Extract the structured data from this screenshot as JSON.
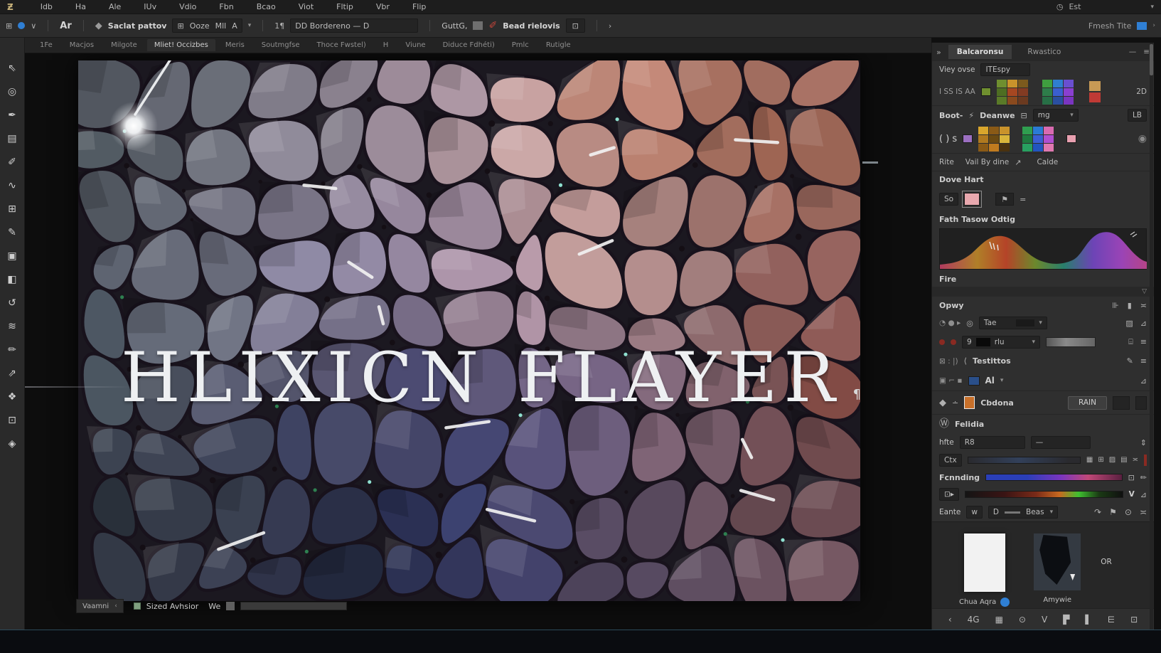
{
  "colors": {
    "accent_blue": "#2f7fd4",
    "panel_bg": "#2f2f2f",
    "canvas_bg": "#0d0d0d",
    "title_text": "#eef0f2",
    "logo_gold": "#c8b27a"
  },
  "menu": {
    "logo": "Ƶ",
    "items": [
      "Idb",
      "Ha",
      "Ale",
      "IUv",
      "Vdio",
      "Fbn",
      "Bcao",
      "Viot",
      "Fltip",
      "Vbr",
      "Flip"
    ],
    "right_label": "Est",
    "clock_icon": "◷",
    "caret": "▾"
  },
  "options_bar": {
    "grid_icon": "⊞",
    "chevron": "∨",
    "brand": "Ar",
    "diamond_icon": "◆",
    "select_label": "Saclat pattov",
    "dd_seg1": "Ooze",
    "dd_seg2": "Mll",
    "dd_seg3": "A",
    "para_icon": "1¶",
    "long_field": "DD Bordereno — D",
    "small_field": "GuttG,",
    "brush_icon": "✐",
    "metrics_label": "Bead rielovis",
    "box_icon": "⊡",
    "right_label": "Fmesh Tite",
    "right_chevron": "›"
  },
  "tabstrip": {
    "tabs": [
      "1Fe",
      "Macjos",
      "Milgote",
      "Mliet! Occizbes",
      "Meris",
      "Soutmgfse",
      "Thoce Fwstel)",
      "H",
      "Viune",
      "Diduce Fdhéti)",
      "Pmlc",
      "Rutigle"
    ]
  },
  "tools": {
    "items": [
      "⇖",
      "◎",
      "✒",
      "▤",
      "✐",
      "∿",
      "⊞",
      "✎",
      "▣",
      "◧",
      "↺",
      "≋",
      "✏",
      "⇗",
      "❖",
      "⊡",
      "◈"
    ]
  },
  "canvas": {
    "title_word1": "HLIXICN",
    "title_word2": "FLAYER",
    "title_mark": "¶"
  },
  "status_bar": {
    "left_label": "Vaamni",
    "left_chevron": "‹",
    "doc_label": "Sized Avhsior",
    "zoom_label": "We"
  },
  "right_panel": {
    "collapse_icon": "»",
    "tab_active": "Balcaronsu",
    "tab_inactive": "Rwastico",
    "tab_min_icon": "—",
    "tab_menu_icon": "≡",
    "view_label1": "Viey ovse",
    "view_label2": "ITEspy",
    "swatch_label": "I SS IS AA",
    "swatch_suffix": "2D",
    "swatches_a": [
      "#6f8f2f",
      "#c9932b",
      "#7c5a1d",
      "#4e6e22",
      "#a64721",
      "#833b22",
      "#5a7a28",
      "#8a4a1e",
      "#6b3a20"
    ],
    "swatches_b": [
      "#3f9e3f",
      "#2f7fd0",
      "#6a4fd0",
      "#2e7d4a",
      "#3a5fd0",
      "#8a3fd0",
      "#276f46",
      "#2a4fa0",
      "#7a35c0"
    ],
    "swatch_pair": [
      "#c89a55",
      "#c03a35"
    ],
    "boot_label": "Boot-",
    "boot_bolt_icon": "⚡",
    "boot_label2": "Deanwe",
    "boot_grid_icon": "⊟",
    "boot_dd": "mg",
    "boot_btn": "LB",
    "row2_prefix": "( ) s",
    "row2_purple": "#9b6fc0",
    "swatches_c": [
      "#d9a62c",
      "#8a5a16",
      "#c9932b",
      "#b0791f",
      "#6b4a12",
      "#d9b53a",
      "#8a5a16",
      "#c07b1f",
      "#4a3210"
    ],
    "swatches_d": [
      "#2f9e4f",
      "#2a7bd4",
      "#d86ab0",
      "#1f7a3f",
      "#3a5fd4",
      "#b04fd0",
      "#28a060",
      "#2255c0",
      "#e078b0"
    ],
    "row2_pink": "#e8a0b0",
    "eye_icon": "◉",
    "link1": "Rite",
    "link2": "Vail By dine",
    "link_arrow": "↗",
    "link3": "Calde",
    "dove_header": "Dove Hart",
    "so_label": "So",
    "so_swatch": "#e8a8ae",
    "filter_icon": "⚑",
    "eq_icon": "=",
    "gradient_label": "Fath Tasow Odtig",
    "fire_label": "Fire",
    "collapse2_icon": "▽",
    "opacity_header": "Opwy",
    "op_icons": [
      "⊪",
      "▮",
      "≍"
    ],
    "tae_prefix_icons": "◔ ● ▸",
    "tae_circle_icon": "◎",
    "tae_label": "Tae",
    "tae_right1": "▨",
    "tae_right2": "⊿",
    "rlu_num": "9",
    "rlu_label": "rlu",
    "rlu_right1": "⌸",
    "rlu_right2": "≡",
    "test_prefix": "⊠ : |)",
    "test_pen_icon": "⟨",
    "test_label": "Testittos",
    "test_right1": "✎",
    "test_right2": "≡",
    "al_icons": "▣ ⌐ ▪",
    "al_label": "Al",
    "al_right": "⊿",
    "cb_icon1": "◆",
    "cb_icon2": "∸",
    "cb_swatch": "#c8702a",
    "cb_label": "Cbdona",
    "cb_btn": "RAIN",
    "fel_icon": "Ⓦ",
    "fel_label": "Felidia",
    "hfte_label": "hfte",
    "hfte_val": "R8",
    "hfte_val2": "—",
    "hfte_right": "⇕",
    "ctx_label": "Ctx",
    "ctx_icons": [
      "▦",
      "⊞",
      "▨",
      "▤",
      "≍"
    ],
    "feather_label": "Fcnnding",
    "feather_right1": "⊡",
    "feather_right2": "✏",
    "grad2_icon": "⊡▸",
    "grad2_v": "V",
    "grad2_right": "⊿",
    "eante_label": "Eante",
    "eante_b": "w",
    "eante_c": "D",
    "eante_d": "Beas",
    "eante_icons": [
      "↷",
      "⚑",
      "⊙",
      "≍"
    ],
    "thumb1_label": "Chua Aqra",
    "thumb2_label": "Amywie",
    "thumb_note": "OR",
    "bottom_icons": [
      "‹",
      "4G",
      "▦",
      "⊙",
      "V",
      "▛",
      "▌",
      "⋿",
      "⊡"
    ]
  }
}
